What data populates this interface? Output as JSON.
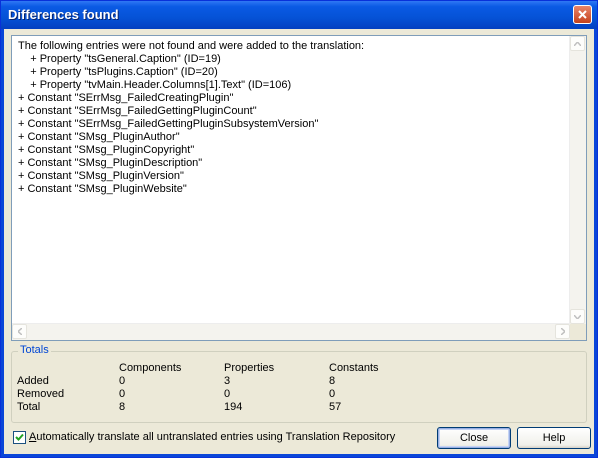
{
  "window": {
    "title": "Differences found"
  },
  "list": {
    "lines": [
      "The following entries were not found and were added to the translation:",
      "    + Property \"tsGeneral.Caption\" (ID=19)",
      "    + Property \"tsPlugins.Caption\" (ID=20)",
      "    + Property \"tvMain.Header.Columns[1].Text\" (ID=106)",
      "+ Constant \"SErrMsg_FailedCreatingPlugin\"",
      "+ Constant \"SErrMsg_FailedGettingPluginCount\"",
      "+ Constant \"SErrMsg_FailedGettingPluginSubsystemVersion\"",
      "+ Constant \"SMsg_PluginAuthor\"",
      "+ Constant \"SMsg_PluginCopyright\"",
      "+ Constant \"SMsg_PluginDescription\"",
      "+ Constant \"SMsg_PluginVersion\"",
      "+ Constant \"SMsg_PluginWebsite\""
    ]
  },
  "totals": {
    "legend": "Totals",
    "headers": [
      "Components",
      "Properties",
      "Constants"
    ],
    "rows": [
      {
        "label": "Added",
        "values": [
          "0",
          "3",
          "8"
        ]
      },
      {
        "label": "Removed",
        "values": [
          "0",
          "0",
          "0"
        ]
      },
      {
        "label": "Total",
        "values": [
          "8",
          "194",
          "57"
        ]
      }
    ]
  },
  "options": {
    "auto_translate_label_accel": "A",
    "auto_translate_label_rest": "utomatically translate all untranslated entries using Translation Repository",
    "auto_translate_checked": true
  },
  "buttons": {
    "close": "Close",
    "help": "Help"
  },
  "colors": {
    "title_bar": "#0552d6",
    "dialog_bg": "#ece9d8",
    "legend_text": "#0046d5"
  }
}
